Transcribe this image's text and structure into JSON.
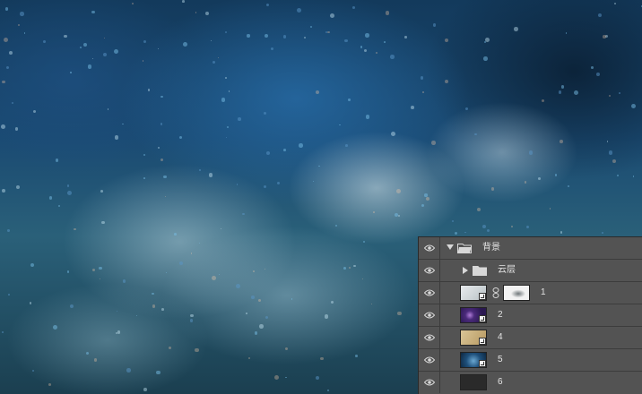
{
  "canvas": {
    "description_colors": {
      "sky_dark": "#133a5c",
      "sky_mid": "#2a6079",
      "cloud": "#c8dce4"
    }
  },
  "layers_panel": {
    "background": "#535353",
    "rows": [
      {
        "name": "背景",
        "kind": "group",
        "expanded": true,
        "visible": true,
        "icon": "folder-icon"
      },
      {
        "name": "云层",
        "kind": "group",
        "expanded": false,
        "visible": true,
        "icon": "folder-icon"
      },
      {
        "name": "1",
        "kind": "smart-object-with-mask",
        "visible": true,
        "thumb_color": "#cfd4d6",
        "mask_thumb": "cloud-mask-thumbnail"
      },
      {
        "name": "2",
        "kind": "smart-object",
        "visible": true,
        "thumb_color": "#4a2a7a"
      },
      {
        "name": "4",
        "kind": "smart-object",
        "visible": true,
        "thumb_color": "#c9b07a"
      },
      {
        "name": "5",
        "kind": "smart-object",
        "visible": true,
        "thumb_color": "#1e4f7a"
      },
      {
        "name": "6",
        "kind": "layer",
        "visible": true,
        "thumb_color": "#2a2a2a"
      }
    ]
  }
}
